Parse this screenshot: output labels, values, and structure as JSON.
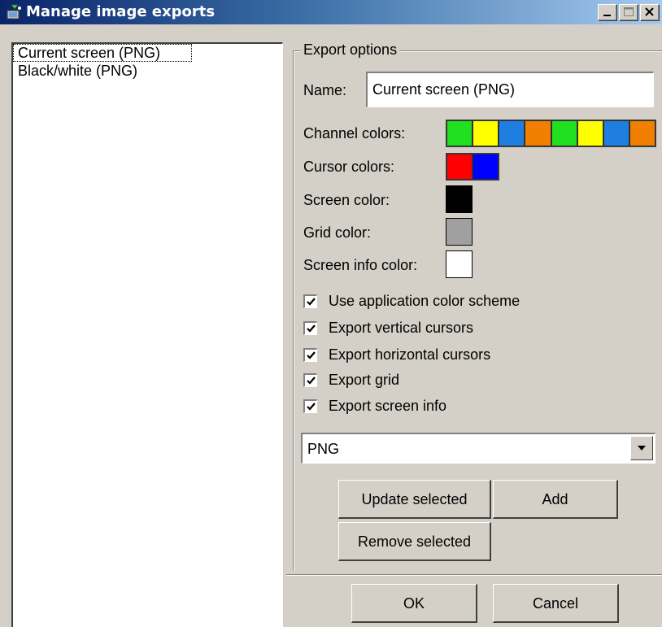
{
  "window": {
    "title": "Manage image exports"
  },
  "list": {
    "items": [
      {
        "label": "Current screen (PNG)"
      },
      {
        "label": "Black/white (PNG)"
      }
    ]
  },
  "options": {
    "group_title": "Export options",
    "name_label": "Name:",
    "name_value": "Current screen (PNG)",
    "channel_colors_label": "Channel colors:",
    "channel_colors": [
      "#20e020",
      "#ffff00",
      "#1e7fe0",
      "#f07f00",
      "#20e020",
      "#ffff00",
      "#1e7fe0",
      "#f07f00"
    ],
    "cursor_colors_label": "Cursor colors:",
    "cursor_colors": [
      "#ff0000",
      "#0000ff"
    ],
    "screen_color_label": "Screen color:",
    "screen_color": "#000000",
    "grid_color_label": "Grid color:",
    "grid_color": "#a0a0a0",
    "screen_info_color_label": "Screen info color:",
    "screen_info_color": "#ffffff",
    "checkboxes": [
      {
        "label": "Use application color scheme",
        "checked": true
      },
      {
        "label": "Export vertical cursors",
        "checked": true
      },
      {
        "label": "Export horizontal cursors",
        "checked": true
      },
      {
        "label": "Export grid",
        "checked": true
      },
      {
        "label": "Export screen info",
        "checked": true
      }
    ],
    "format": {
      "selected": "PNG"
    }
  },
  "buttons": {
    "update": "Update selected",
    "add": "Add",
    "remove": "Remove selected",
    "ok": "OK",
    "cancel": "Cancel"
  }
}
